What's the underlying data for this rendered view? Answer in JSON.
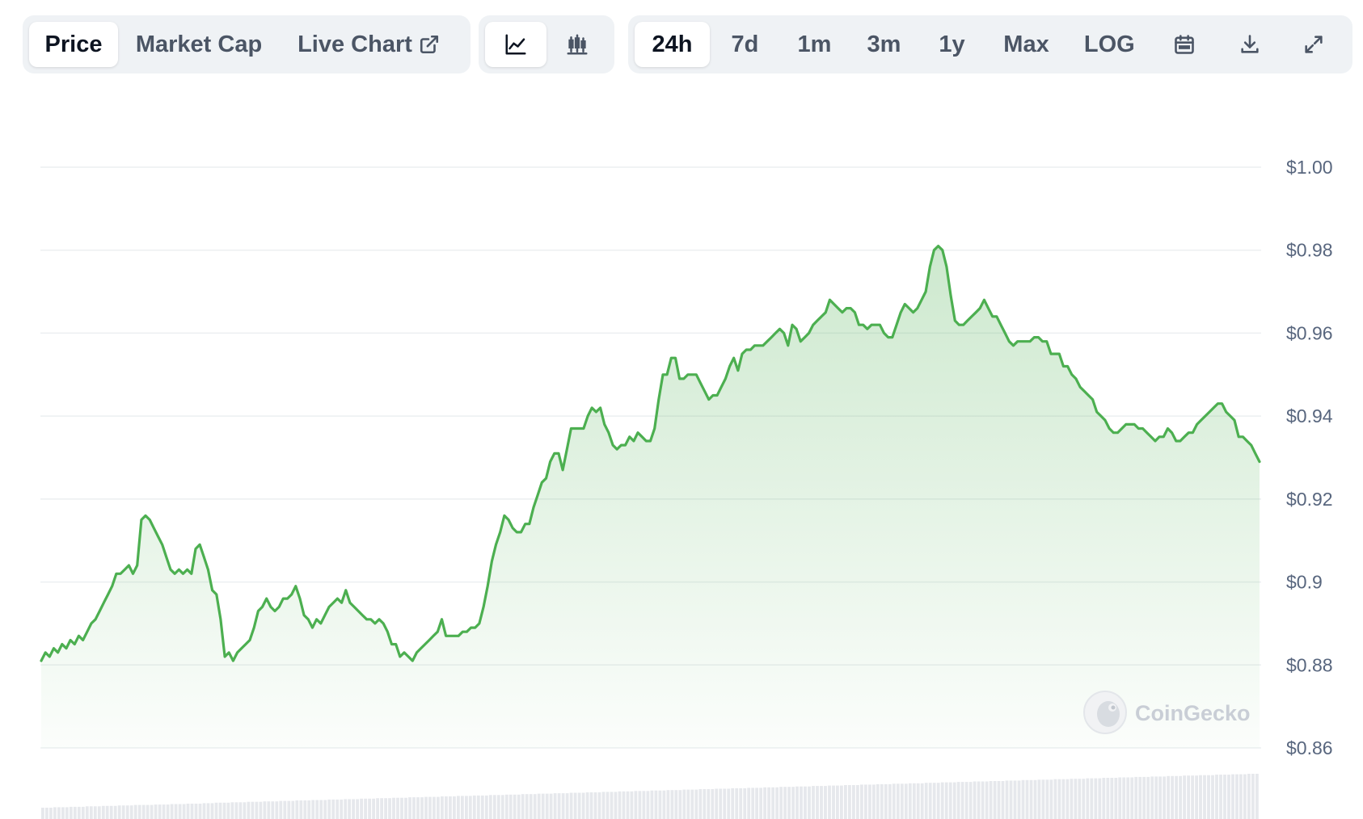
{
  "toolbar": {
    "tabs": [
      "Price",
      "Market Cap",
      "Live Chart"
    ],
    "chart_types": [
      "line-chart-icon",
      "candlestick-icon"
    ],
    "ranges": [
      "24h",
      "7d",
      "1m",
      "3m",
      "1y",
      "Max",
      "LOG"
    ],
    "icons": [
      "calendar-icon",
      "download-icon",
      "expand-icon"
    ],
    "active_tab": "Price",
    "active_chart_type": "line",
    "active_range": "24h"
  },
  "watermark": {
    "text": "CoinGecko"
  },
  "colors": {
    "line": "#4caf50",
    "fill": "#4caf50",
    "grid": "#eceff1",
    "axis_text": "#58667e"
  },
  "chart_data": {
    "type": "area",
    "ytick_labels": [
      "$1.00",
      "$0.98",
      "$0.96",
      "$0.94",
      "$0.92",
      "$0.9",
      "$0.88",
      "$0.86"
    ],
    "yticks": [
      1.0,
      0.98,
      0.96,
      0.94,
      0.92,
      0.9,
      0.88,
      0.86
    ],
    "ylim": [
      0.86,
      1.0
    ],
    "grid": true,
    "y_axis_position": "right",
    "x_range": "24h",
    "series": [
      {
        "values": [
          0.881,
          0.883,
          0.882,
          0.884,
          0.883,
          0.885,
          0.884,
          0.886,
          0.885,
          0.887,
          0.886,
          0.888,
          0.89,
          0.891,
          0.893,
          0.895,
          0.897,
          0.899,
          0.902,
          0.902,
          0.903,
          0.904,
          0.902,
          0.904,
          0.915,
          0.916,
          0.915,
          0.913,
          0.911,
          0.909,
          0.906,
          0.903,
          0.902,
          0.903,
          0.902,
          0.903,
          0.902,
          0.908,
          0.909,
          0.906,
          0.903,
          0.898,
          0.897,
          0.891,
          0.882,
          0.883,
          0.881,
          0.883,
          0.884,
          0.885,
          0.886,
          0.889,
          0.893,
          0.894,
          0.896,
          0.894,
          0.893,
          0.894,
          0.896,
          0.896,
          0.897,
          0.899,
          0.896,
          0.892,
          0.891,
          0.889,
          0.891,
          0.89,
          0.892,
          0.894,
          0.895,
          0.896,
          0.895,
          0.898,
          0.895,
          0.894,
          0.893,
          0.892,
          0.891,
          0.891,
          0.89,
          0.891,
          0.89,
          0.888,
          0.885,
          0.885,
          0.882,
          0.883,
          0.882,
          0.881,
          0.883,
          0.884,
          0.885,
          0.886,
          0.887,
          0.888,
          0.891,
          0.887,
          0.887,
          0.887,
          0.887,
          0.888,
          0.888,
          0.889,
          0.889,
          0.89,
          0.894,
          0.899,
          0.905,
          0.909,
          0.912,
          0.916,
          0.915,
          0.913,
          0.912,
          0.912,
          0.914,
          0.914,
          0.918,
          0.921,
          0.924,
          0.925,
          0.929,
          0.931,
          0.931,
          0.927,
          0.932,
          0.937,
          0.937,
          0.937,
          0.937,
          0.94,
          0.942,
          0.941,
          0.942,
          0.938,
          0.936,
          0.933,
          0.932,
          0.933,
          0.933,
          0.935,
          0.934,
          0.936,
          0.935,
          0.934,
          0.934,
          0.937,
          0.944,
          0.95,
          0.95,
          0.954,
          0.954,
          0.949,
          0.949,
          0.95,
          0.95,
          0.95,
          0.948,
          0.946,
          0.944,
          0.945,
          0.945,
          0.947,
          0.949,
          0.952,
          0.954,
          0.951,
          0.955,
          0.956,
          0.956,
          0.957,
          0.957,
          0.957,
          0.958,
          0.959,
          0.96,
          0.961,
          0.96,
          0.957,
          0.962,
          0.961,
          0.958,
          0.959,
          0.96,
          0.962,
          0.963,
          0.964,
          0.965,
          0.968,
          0.967,
          0.966,
          0.965,
          0.966,
          0.966,
          0.965,
          0.962,
          0.962,
          0.961,
          0.962,
          0.962,
          0.962,
          0.96,
          0.959,
          0.959,
          0.962,
          0.965,
          0.967,
          0.966,
          0.965,
          0.966,
          0.968,
          0.97,
          0.976,
          0.98,
          0.981,
          0.98,
          0.976,
          0.969,
          0.963,
          0.962,
          0.962,
          0.963,
          0.964,
          0.965,
          0.966,
          0.968,
          0.966,
          0.964,
          0.964,
          0.962,
          0.96,
          0.958,
          0.957,
          0.958,
          0.958,
          0.958,
          0.958,
          0.959,
          0.959,
          0.958,
          0.958,
          0.955,
          0.955,
          0.955,
          0.952,
          0.952,
          0.95,
          0.949,
          0.947,
          0.946,
          0.945,
          0.944,
          0.941,
          0.94,
          0.939,
          0.937,
          0.936,
          0.936,
          0.937,
          0.938,
          0.938,
          0.938,
          0.937,
          0.937,
          0.936,
          0.935,
          0.934,
          0.935,
          0.935,
          0.937,
          0.936,
          0.934,
          0.934,
          0.935,
          0.936,
          0.936,
          0.938,
          0.939,
          0.94,
          0.941,
          0.942,
          0.943,
          0.943,
          0.941,
          0.94,
          0.939,
          0.935,
          0.935,
          0.934,
          0.933,
          0.931,
          0.929
        ]
      }
    ],
    "volume_values": [
      0.25,
      0.25,
      0.25,
      0.26,
      0.26,
      0.26,
      0.26,
      0.27,
      0.27,
      0.27,
      0.27,
      0.28,
      0.28,
      0.28,
      0.28,
      0.29,
      0.29,
      0.29,
      0.29,
      0.3,
      0.3,
      0.3,
      0.3,
      0.31,
      0.31,
      0.31,
      0.31,
      0.31,
      0.32,
      0.32,
      0.32,
      0.32,
      0.33,
      0.33,
      0.33,
      0.33,
      0.34,
      0.34,
      0.34,
      0.34,
      0.35,
      0.35,
      0.35,
      0.36,
      0.36,
      0.36,
      0.36,
      0.37,
      0.37,
      0.37,
      0.37,
      0.38,
      0.38,
      0.38,
      0.38,
      0.39,
      0.39,
      0.39,
      0.39,
      0.4,
      0.4,
      0.4,
      0.4,
      0.41,
      0.41,
      0.41,
      0.41,
      0.42,
      0.42,
      0.42,
      0.42,
      0.43,
      0.43,
      0.43,
      0.43,
      0.44,
      0.44,
      0.44,
      0.44,
      0.45,
      0.45,
      0.45,
      0.45,
      0.46,
      0.46,
      0.46,
      0.46,
      0.47,
      0.47,
      0.47,
      0.47,
      0.48,
      0.48,
      0.48,
      0.48,
      0.49,
      0.49,
      0.49,
      0.49,
      0.5,
      0.5,
      0.5,
      0.5,
      0.51,
      0.51,
      0.51,
      0.51,
      0.52,
      0.52,
      0.52,
      0.52,
      0.53,
      0.53,
      0.53,
      0.53,
      0.54,
      0.54,
      0.54,
      0.54,
      0.55,
      0.55,
      0.55,
      0.55,
      0.56,
      0.56,
      0.56,
      0.56,
      0.57,
      0.57,
      0.57,
      0.57,
      0.58,
      0.58,
      0.58,
      0.58,
      0.59,
      0.59,
      0.59,
      0.59,
      0.6,
      0.6,
      0.6,
      0.6,
      0.61,
      0.61,
      0.61,
      0.61,
      0.62,
      0.62,
      0.62,
      0.62,
      0.63,
      0.63,
      0.63,
      0.63,
      0.64,
      0.64,
      0.64,
      0.64,
      0.65,
      0.65,
      0.65,
      0.65,
      0.66,
      0.66,
      0.66,
      0.66,
      0.67,
      0.67,
      0.67,
      0.67,
      0.68,
      0.68,
      0.68,
      0.68,
      0.69,
      0.69,
      0.69,
      0.69,
      0.7,
      0.7,
      0.7,
      0.7,
      0.71,
      0.71,
      0.71,
      0.71,
      0.72,
      0.72,
      0.72,
      0.72,
      0.73,
      0.73,
      0.73,
      0.73,
      0.74,
      0.74,
      0.74,
      0.74,
      0.75,
      0.75,
      0.75,
      0.75,
      0.76,
      0.76,
      0.76,
      0.76,
      0.77,
      0.77,
      0.77,
      0.77,
      0.78,
      0.78,
      0.78,
      0.78,
      0.79,
      0.79,
      0.79,
      0.79,
      0.8,
      0.8,
      0.8,
      0.8,
      0.81,
      0.81,
      0.81,
      0.81,
      0.82,
      0.82,
      0.82,
      0.82,
      0.83,
      0.83,
      0.83,
      0.83,
      0.84,
      0.84,
      0.84,
      0.84,
      0.85,
      0.85,
      0.85,
      0.85,
      0.86,
      0.86,
      0.86,
      0.86,
      0.87,
      0.87,
      0.87,
      0.87,
      0.88,
      0.88,
      0.88,
      0.88,
      0.89,
      0.89,
      0.89,
      0.89,
      0.9,
      0.9,
      0.9,
      0.9,
      0.91,
      0.91,
      0.91,
      0.91,
      0.92,
      0.92,
      0.92,
      0.92,
      0.93,
      0.93,
      0.93,
      0.93,
      0.94,
      0.94,
      0.94,
      0.94,
      0.95,
      0.95,
      0.95,
      0.95,
      0.96,
      0.96,
      0.96,
      0.96,
      0.97,
      0.97,
      0.97,
      0.97,
      0.98,
      0.98,
      0.98,
      0.98,
      0.99,
      0.99,
      0.99,
      0.99,
      1.0,
      1.0,
      1.0
    ]
  }
}
